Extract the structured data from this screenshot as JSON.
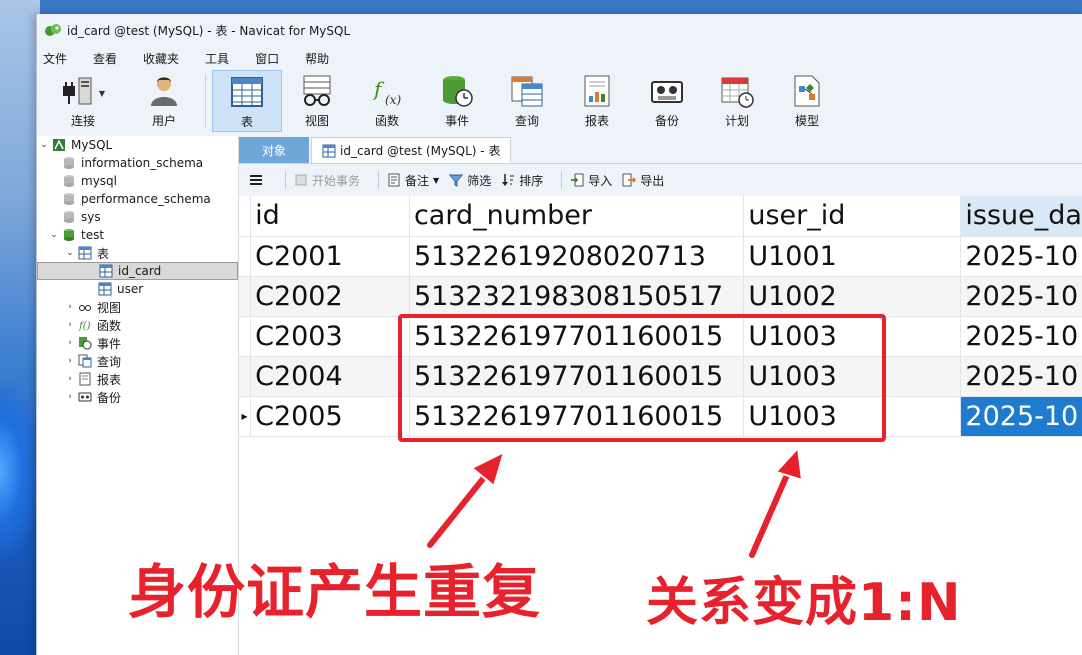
{
  "window": {
    "title": "id_card @test (MySQL) - 表 - Navicat for MySQL"
  },
  "menu": [
    "文件",
    "查看",
    "收藏夹",
    "工具",
    "窗口",
    "帮助"
  ],
  "toolbar": [
    {
      "label": "连接",
      "icon": "connection-plug-icon"
    },
    {
      "label": "用户",
      "icon": "user-icon"
    },
    {
      "label": "表",
      "icon": "table-icon",
      "active": true
    },
    {
      "label": "视图",
      "icon": "view-glasses-icon"
    },
    {
      "label": "函数",
      "icon": "function-icon"
    },
    {
      "label": "事件",
      "icon": "event-clock-icon"
    },
    {
      "label": "查询",
      "icon": "query-icon"
    },
    {
      "label": "报表",
      "icon": "report-icon"
    },
    {
      "label": "备份",
      "icon": "backup-icon"
    },
    {
      "label": "计划",
      "icon": "schedule-calendar-icon"
    },
    {
      "label": "模型",
      "icon": "model-icon"
    }
  ],
  "sidebar": {
    "connection": "MySQL",
    "databases": [
      "information_schema",
      "mysql",
      "performance_schema",
      "sys",
      "test"
    ],
    "tables_group": "表",
    "tables": [
      "id_card",
      "user"
    ],
    "selected_table": "id_card",
    "other_groups": [
      "视图",
      "函数",
      "事件",
      "查询",
      "报表",
      "备份"
    ]
  },
  "tabs": {
    "objects": "对象",
    "table_tab": "id_card @test (MySQL) - 表"
  },
  "subtoolbar": {
    "begin_transaction": "开始事务",
    "note": "备注",
    "filter": "筛选",
    "sort": "排序",
    "import": "导入",
    "export": "导出"
  },
  "grid": {
    "columns": [
      "id",
      "card_number",
      "user_id",
      "issue_da"
    ],
    "rows": [
      [
        "C2001",
        "51322619208020713",
        "U1001",
        "2025-10"
      ],
      [
        "C2002",
        "51323219830815051​7",
        "U1002",
        "2025-10"
      ],
      [
        "C2003",
        "513226197701160015",
        "U1003",
        "2025-10"
      ],
      [
        "C2004",
        "513226197701160015",
        "U1003",
        "2025-10"
      ],
      [
        "C2005",
        "513226197701160015",
        "U1003",
        "2025-10"
      ]
    ],
    "current_row_index": 4
  },
  "annotations": {
    "left_text": "身份证产生重复",
    "right_text": "关系变成1:N",
    "color": "#e8222c"
  }
}
